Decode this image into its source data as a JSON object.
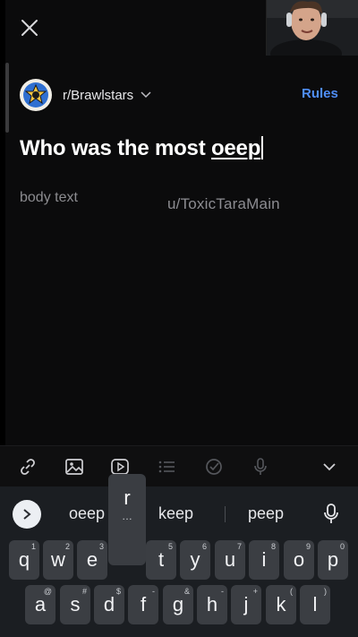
{
  "header": {
    "subreddit": "r/Brawlstars",
    "rules_label": "Rules"
  },
  "post": {
    "title_text": "Who was the most ",
    "title_word": "oeep",
    "body_placeholder": "body text"
  },
  "watermark": "u/ToxicTaraMain",
  "toolbar": {
    "icons": [
      "link-icon",
      "image-icon",
      "video-icon",
      "list-icon",
      "poll-icon",
      "mic-icon",
      "chevron-down-icon"
    ]
  },
  "keyboard": {
    "suggestions": [
      "oeep",
      "keep",
      "peep"
    ],
    "popup_key": "r",
    "popup_more": "…",
    "row1": [
      {
        "k": "q",
        "h": "1"
      },
      {
        "k": "w",
        "h": "2"
      },
      {
        "k": "e",
        "h": "3"
      },
      {
        "k": "t",
        "h": "5"
      },
      {
        "k": "y",
        "h": "6"
      },
      {
        "k": "u",
        "h": "7"
      },
      {
        "k": "i",
        "h": "8"
      },
      {
        "k": "o",
        "h": "9"
      },
      {
        "k": "p",
        "h": "0"
      }
    ],
    "row2": [
      {
        "k": "a",
        "h": "@"
      },
      {
        "k": "s",
        "h": "#"
      },
      {
        "k": "d",
        "h": "$"
      },
      {
        "k": "f",
        "h": "-"
      },
      {
        "k": "g",
        "h": "&"
      },
      {
        "k": "h",
        "h": "-"
      },
      {
        "k": "j",
        "h": "+"
      },
      {
        "k": "k",
        "h": "("
      },
      {
        "k": "l",
        "h": ")"
      }
    ]
  },
  "colors": {
    "accent": "#4f8ef7",
    "background": "#0b0b0c",
    "keyboard": "#1b1e22",
    "key": "#3b3e43"
  }
}
